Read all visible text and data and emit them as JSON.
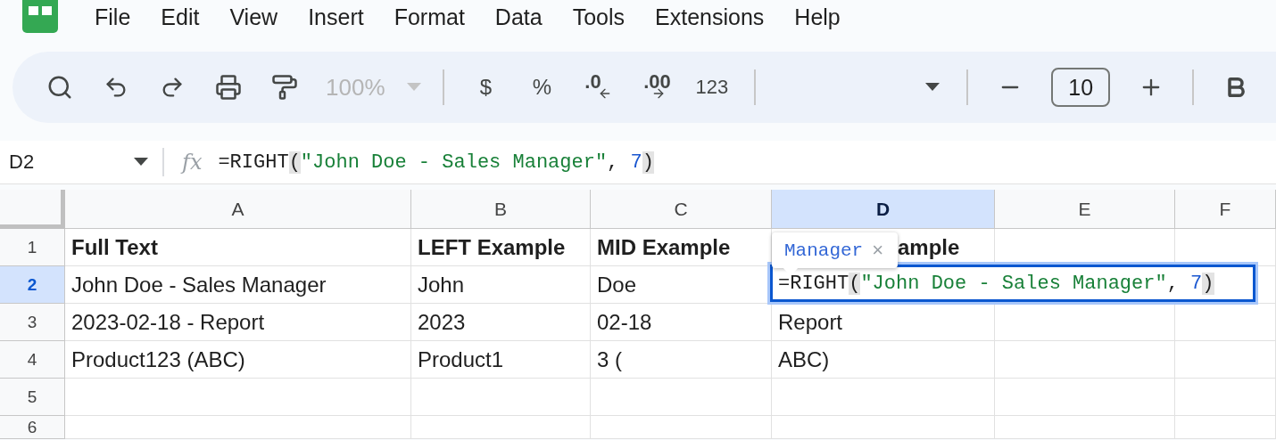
{
  "menu": [
    "File",
    "Edit",
    "View",
    "Insert",
    "Format",
    "Data",
    "Tools",
    "Extensions",
    "Help"
  ],
  "toolbar": {
    "zoom": "100%",
    "currency": "$",
    "percent": "%",
    "decrease_decimal": ".0",
    "increase_decimal": ".00",
    "number_format": "123",
    "font_size": "10"
  },
  "formula_bar": {
    "cell_name": "D2",
    "function_symbol": "fx",
    "tokens": [
      {
        "kind": "plain",
        "text": "=RIGHT"
      },
      {
        "kind": "paren",
        "text": "("
      },
      {
        "kind": "string",
        "text": "\"John Doe - Sales Manager\""
      },
      {
        "kind": "plain",
        "text": ", "
      },
      {
        "kind": "number",
        "text": "7"
      },
      {
        "kind": "paren",
        "text": ")"
      }
    ]
  },
  "columns": [
    {
      "label": "A",
      "selected": false
    },
    {
      "label": "B",
      "selected": false
    },
    {
      "label": "C",
      "selected": false
    },
    {
      "label": "D",
      "selected": true
    },
    {
      "label": "E",
      "selected": false
    },
    {
      "label": "F",
      "selected": false
    }
  ],
  "rows": [
    {
      "number": "1",
      "selected": false,
      "kind": "header",
      "cells": [
        "Full Text",
        "LEFT Example",
        "MID Example",
        "ample"
      ]
    },
    {
      "number": "2",
      "selected": true,
      "kind": "data",
      "cells": [
        "John Doe - Sales Manager",
        "John",
        "Doe"
      ]
    },
    {
      "number": "3",
      "selected": false,
      "kind": "data",
      "cells": [
        "2023-02-18 - Report",
        "2023",
        "02-18",
        "Report"
      ]
    },
    {
      "number": "4",
      "selected": false,
      "kind": "data",
      "cells": [
        "Product123 (ABC)",
        "Product1",
        "3 (",
        "ABC)"
      ]
    },
    {
      "number": "5",
      "selected": false,
      "kind": "data"
    },
    {
      "number": "6",
      "selected": false,
      "kind": "data"
    }
  ],
  "cell_editor": {
    "tokens": [
      {
        "kind": "plain",
        "text": "=RIGHT"
      },
      {
        "kind": "paren",
        "text": "("
      },
      {
        "kind": "string",
        "text": "\"John Doe - Sales Manager\""
      },
      {
        "kind": "plain",
        "text": ", "
      },
      {
        "kind": "number",
        "text": "7"
      },
      {
        "kind": "paren",
        "text": ")"
      }
    ]
  },
  "preview_tooltip": {
    "value": "Manager",
    "close": "×"
  }
}
